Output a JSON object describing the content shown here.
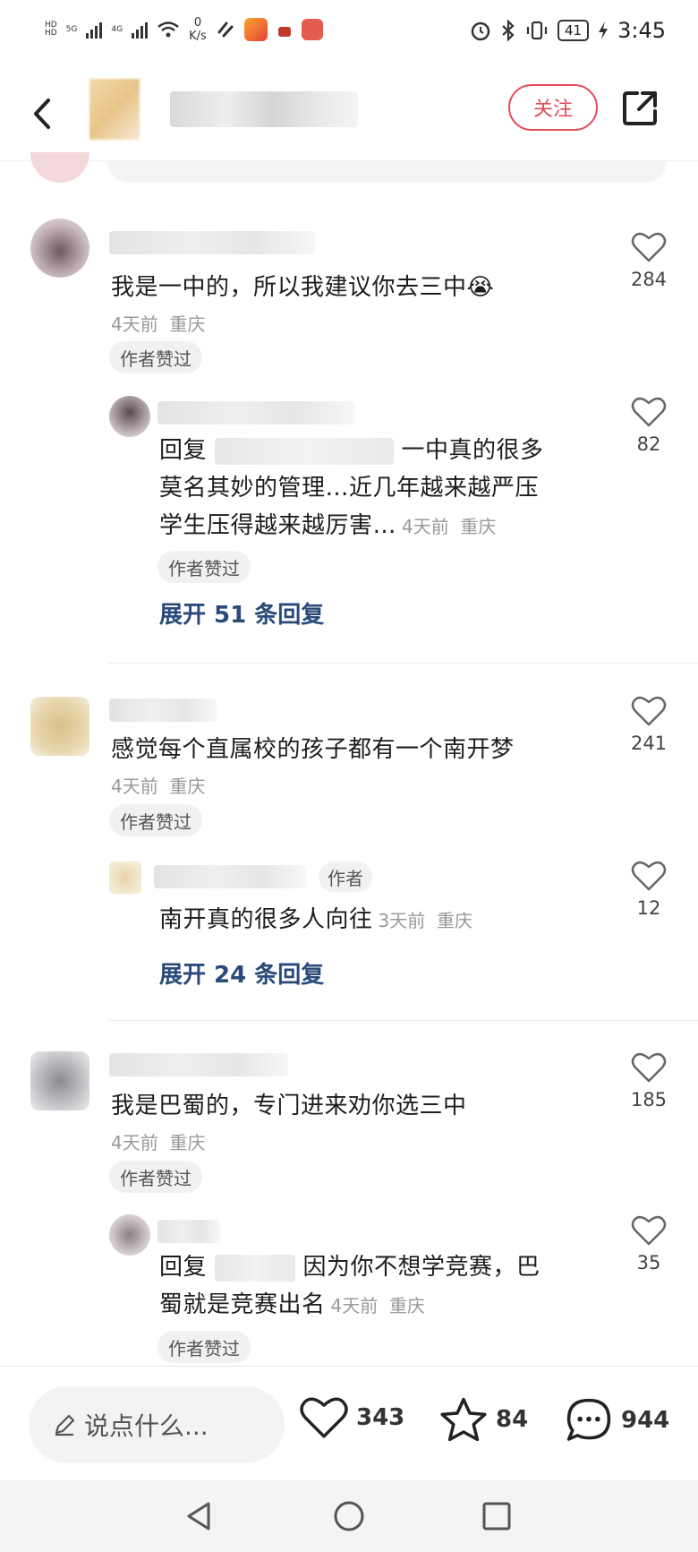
{
  "status_bar": {
    "hd1": "HD",
    "hd2": "HD",
    "net1": "5G",
    "net2": "4G",
    "speed_value": "0",
    "speed_unit": "K/s",
    "battery": "41",
    "time": "3:45"
  },
  "header": {
    "follow_label": "关注"
  },
  "comments": [
    {
      "text": "我是一中的，所以我建议你去三中",
      "time": "4天前",
      "location": "重庆",
      "chip": "作者赞过",
      "likes": "284",
      "reply": {
        "reply_prefix": "回复",
        "text_line1": "一中真的很多",
        "text_line2": "莫名其妙的管理…近几年越来越严压",
        "text_line3": "学生压得越来越厉害…",
        "time": "4天前",
        "location": "重庆",
        "chip": "作者赞过",
        "likes": "82"
      },
      "expand_label": "展开 51 条回复"
    },
    {
      "text": "感觉每个直属校的孩子都有一个南开梦",
      "time": "4天前",
      "location": "重庆",
      "chip": "作者赞过",
      "likes": "241",
      "reply": {
        "author_tag": "作者",
        "text": "南开真的很多人向往",
        "time": "3天前",
        "location": "重庆",
        "likes": "12"
      },
      "expand_label": "展开 24 条回复"
    },
    {
      "text": "我是巴蜀的，专门进来劝你选三中",
      "time": "4天前",
      "location": "重庆",
      "chip": "作者赞过",
      "likes": "185",
      "reply": {
        "reply_prefix": "回复",
        "text_line1": "因为你不想学竞赛，巴",
        "text_line2": "蜀就是竞赛出名",
        "time": "4天前",
        "location": "重庆",
        "chip": "作者赞过",
        "likes": "35"
      }
    }
  ],
  "bottom_bar": {
    "input_placeholder": "说点什么...",
    "likes": "343",
    "favorites": "84",
    "comments": "944"
  },
  "colors": {
    "accent_red": "#e14b5a",
    "expand_blue": "#2a4a7a"
  }
}
